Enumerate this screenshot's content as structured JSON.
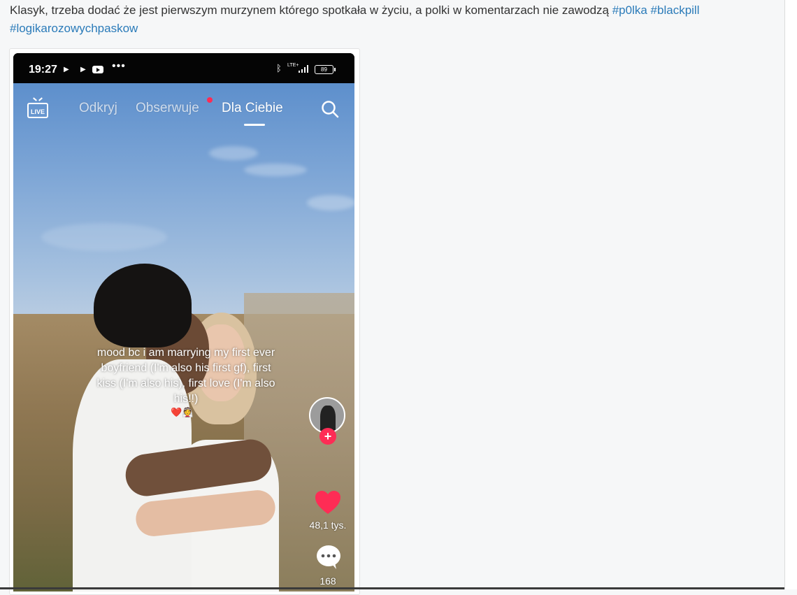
{
  "post": {
    "text": "Klasyk, trzeba dodać że jest pierwszym murzynem którego spotkała w życiu, a polki w komentarzach nie zawodzą ",
    "tags": [
      "#p0lka",
      "#blackpill",
      "#logikarozowychpaskow"
    ]
  },
  "phone_status": {
    "time": "19:27",
    "dots": "•••",
    "lte": "LTE+",
    "battery": "89",
    "icons": [
      "play-icon",
      "play-icon",
      "youtube-icon",
      "bluetooth-icon",
      "signal-icon",
      "battery-icon"
    ]
  },
  "tiktok": {
    "live_label": "LIVE",
    "tabs": [
      "Odkryj",
      "Obserwuje",
      "Dla Ciebie"
    ],
    "active_tab": "Dla Ciebie",
    "caption_lines": [
      "mood bc i am marrying my first ever",
      "boyfriend (I'm also his first gf), first",
      "kiss (I'm also his), first love (I'm also",
      "his!!)"
    ],
    "emoji_line": "❤️👰",
    "likes": "48,1 tys.",
    "comments": "168",
    "colors": {
      "accent": "#fe2c55",
      "link": "#2b7bb9"
    }
  }
}
